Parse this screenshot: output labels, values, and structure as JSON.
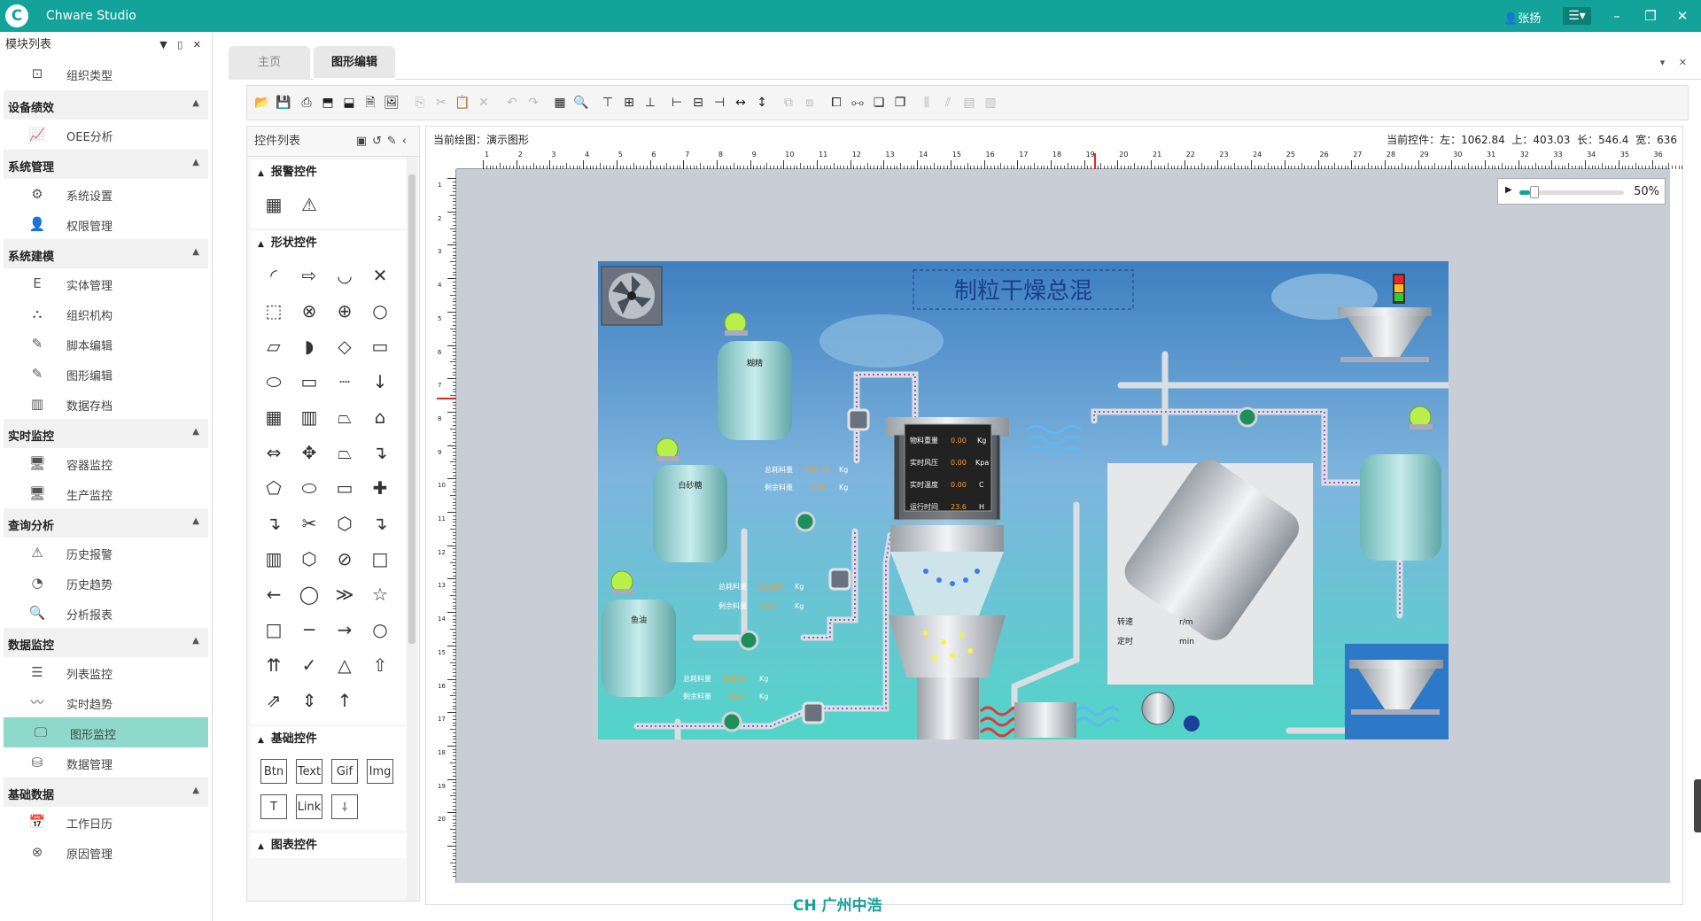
{
  "app": {
    "title": "Chware Studio",
    "user": "张扬",
    "brand_color": "#13a39a"
  },
  "left_panel": {
    "title": "模块列表",
    "top_item": {
      "label": "组织类型",
      "icon": "org-type-icon"
    },
    "groups": [
      {
        "title": "设备绩效",
        "items": [
          {
            "label": "OEE分析",
            "icon": "oee-chart-icon"
          }
        ]
      },
      {
        "title": "系统管理",
        "items": [
          {
            "label": "系统设置",
            "icon": "gear-icon"
          },
          {
            "label": "权限管理",
            "icon": "user-key-icon"
          }
        ]
      },
      {
        "title": "系统建模",
        "items": [
          {
            "label": "实体管理",
            "icon": "entity-icon"
          },
          {
            "label": "组织机构",
            "icon": "org-tree-icon"
          },
          {
            "label": "脚本编辑",
            "icon": "script-edit-icon"
          },
          {
            "label": "图形编辑",
            "icon": "graphic-edit-icon"
          },
          {
            "label": "数据存档",
            "icon": "archive-icon"
          }
        ]
      },
      {
        "title": "实时监控",
        "items": [
          {
            "label": "容器监控",
            "icon": "container-monitor-icon"
          },
          {
            "label": "生产监控",
            "icon": "production-monitor-icon"
          }
        ]
      },
      {
        "title": "查询分析",
        "items": [
          {
            "label": "历史报警",
            "icon": "history-alarm-icon"
          },
          {
            "label": "历史趋势",
            "icon": "history-trend-icon"
          },
          {
            "label": "分析报表",
            "icon": "analysis-report-icon"
          }
        ]
      },
      {
        "title": "数据监控",
        "items": [
          {
            "label": "列表监控",
            "icon": "list-monitor-icon"
          },
          {
            "label": "实时趋势",
            "icon": "realtime-trend-icon"
          },
          {
            "label": "图形监控",
            "icon": "graphic-monitor-icon",
            "active": true
          },
          {
            "label": "数据管理",
            "icon": "database-icon"
          }
        ]
      },
      {
        "title": "基础数据",
        "items": [
          {
            "label": "工作日历",
            "icon": "calendar-icon"
          },
          {
            "label": "原因管理",
            "icon": "reason-icon"
          }
        ]
      }
    ]
  },
  "tabs": [
    {
      "label": "主页",
      "active": false
    },
    {
      "label": "图形编辑",
      "active": true
    }
  ],
  "control_panel": {
    "title": "控件列表",
    "sections": [
      {
        "title": "报警控件",
        "items": [
          "▦",
          "⚠"
        ]
      },
      {
        "title": "形状控件",
        "items": [
          "◜",
          "⇨",
          "◡",
          "✕",
          "⬚",
          "⊗",
          "⊕",
          "○",
          "▱",
          "◗",
          "◇",
          "▭",
          "⬭",
          "▭",
          "┈",
          "↓",
          "▦",
          "▥",
          "⏢",
          "⌂",
          "⇔",
          "✥",
          "⏢",
          "↴",
          "⬠",
          "⬭",
          "▭",
          "✚",
          "↴",
          "✂",
          "⬡",
          "↴",
          "▥",
          "⬡",
          "⊘",
          "□",
          "←",
          "◯",
          "≫",
          "☆",
          "□",
          "─",
          "→",
          "○",
          "⇈",
          "✓",
          "△",
          "⇧",
          "⇗",
          "⇕",
          "↑"
        ]
      },
      {
        "title": "基础控件",
        "items": [
          "Btn",
          "Text",
          "Gif",
          "Img",
          "T",
          "Link",
          "⸸"
        ]
      },
      {
        "title": "图表控件",
        "items": []
      }
    ]
  },
  "canvas": {
    "current_drawing_label": "当前绘图：",
    "current_drawing": "演示图形",
    "current_control_label": "当前控件：",
    "left_label": "左：",
    "left": "1062.84",
    "top_label": "上：",
    "top": "403.03",
    "length_label": "长：",
    "length": "546.4",
    "width_label": "宽：",
    "width": "636",
    "zoom": "50%",
    "zoom_fraction": 0.5,
    "ruler_labels": [
      "1",
      "2",
      "3",
      "4",
      "5",
      "6",
      "7",
      "8",
      "9",
      "10",
      "11",
      "12",
      "13",
      "14",
      "15",
      "16",
      "17",
      "18",
      "19",
      "20",
      "21",
      "22",
      "23",
      "24",
      "25",
      "26",
      "27",
      "28",
      "29",
      "30",
      "31",
      "32",
      "33",
      "34",
      "35",
      "36"
    ]
  },
  "scene": {
    "title": "制粒干燥总混",
    "tank1": "糊精",
    "tank2": "白砂糖",
    "tank3": "鱼油",
    "total_label": "总耗料量",
    "remain_label": "剩余料量",
    "t1_total": "100.00",
    "t1_remain": "0.00",
    "unit_kg": "Kg",
    "t2_total": "100.00",
    "t2_remain": "0.00",
    "t3_total": "100.00",
    "t3_remain": "0.00",
    "panel_rows": [
      {
        "label": "物料重量",
        "value": "0.00",
        "unit": "Kg"
      },
      {
        "label": "实时风压",
        "value": "0.00",
        "unit": "Kpa"
      },
      {
        "label": "实时温度",
        "value": "0.00",
        "unit": "C"
      },
      {
        "label": "运行时间",
        "value": "23.6",
        "unit": "H"
      }
    ],
    "speed_label": "转速",
    "speed_unit": "r/m",
    "timer_label": "定时",
    "timer_unit": "min"
  },
  "footer": {
    "brand": "广州中浩",
    "logo": "CH"
  }
}
